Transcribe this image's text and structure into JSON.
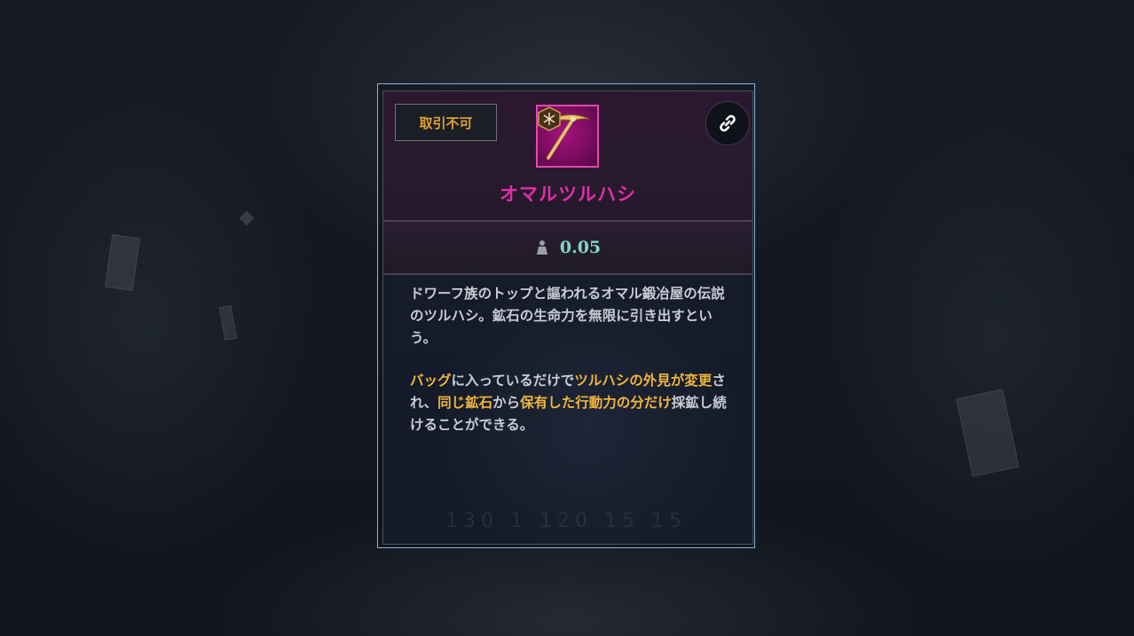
{
  "item": {
    "trade_badge": "取引不可",
    "name": "オマルツルハシ",
    "weight": "0.05",
    "description": {
      "paragraph1": "ドワーフ族のトップと謳われるオマル鍛冶屋の伝説のツルハシ。鉱石の生命力を無限に引き出すという。",
      "paragraph2": [
        {
          "text": "バッグ",
          "highlight": true
        },
        {
          "text": "に入っているだけで",
          "highlight": false
        },
        {
          "text": "ツルハシの外見が変更",
          "highlight": true
        },
        {
          "text": "され、",
          "highlight": false
        },
        {
          "text": "同じ鉱石",
          "highlight": true
        },
        {
          "text": "から",
          "highlight": false
        },
        {
          "text": "保有した行動力の分だけ",
          "highlight": true
        },
        {
          "text": "採鉱し続けることができる。",
          "highlight": false
        }
      ]
    },
    "icon": "pickaxe-icon",
    "rarity_color": "#e02ea6",
    "highlight_color": "#f0b63c"
  },
  "actions": {
    "link_icon": "link-icon"
  }
}
